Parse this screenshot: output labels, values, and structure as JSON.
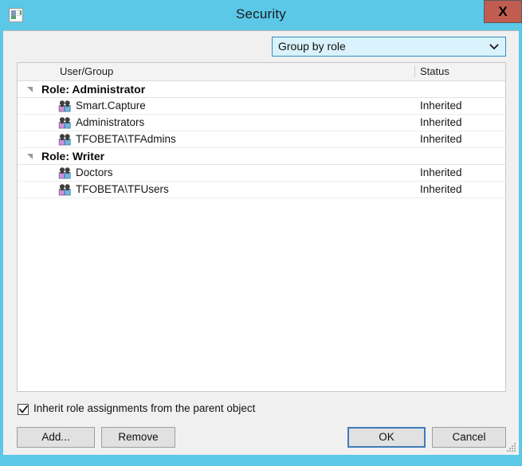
{
  "window": {
    "title": "Security",
    "icon": "window-chart-icon",
    "close_label": "X",
    "accent_titlebar_color": "#5bc8e8",
    "close_button_color": "#c15c51",
    "body_color": "#f0f0f0"
  },
  "toolbar": {
    "group_by": {
      "selected": "Group by role",
      "icon": "chevron-down-icon"
    }
  },
  "list": {
    "columns": [
      {
        "key": "user_group",
        "label": "User/Group"
      },
      {
        "key": "status",
        "label": "Status"
      }
    ],
    "groups": [
      {
        "label": "Role: Administrator",
        "expanded": true,
        "twisty_icon": "expanded-triangle-icon",
        "items": [
          {
            "icon": "group-users-icon",
            "name": "Smart.Capture",
            "status": "Inherited"
          },
          {
            "icon": "group-users-icon",
            "name": "Administrators",
            "status": "Inherited"
          },
          {
            "icon": "group-users-icon",
            "name": "TFOBETA\\TFAdmins",
            "status": "Inherited"
          }
        ]
      },
      {
        "label": "Role: Writer",
        "expanded": true,
        "twisty_icon": "expanded-triangle-icon",
        "items": [
          {
            "icon": "group-users-icon",
            "name": "Doctors",
            "status": "Inherited"
          },
          {
            "icon": "group-users-icon",
            "name": "TFOBETA\\TFUsers",
            "status": "Inherited"
          }
        ]
      }
    ]
  },
  "inherit": {
    "label": "Inherit role assignments from the parent object",
    "checked": true
  },
  "buttons": {
    "add": "Add...",
    "remove": "Remove",
    "ok": "OK",
    "cancel": "Cancel"
  }
}
